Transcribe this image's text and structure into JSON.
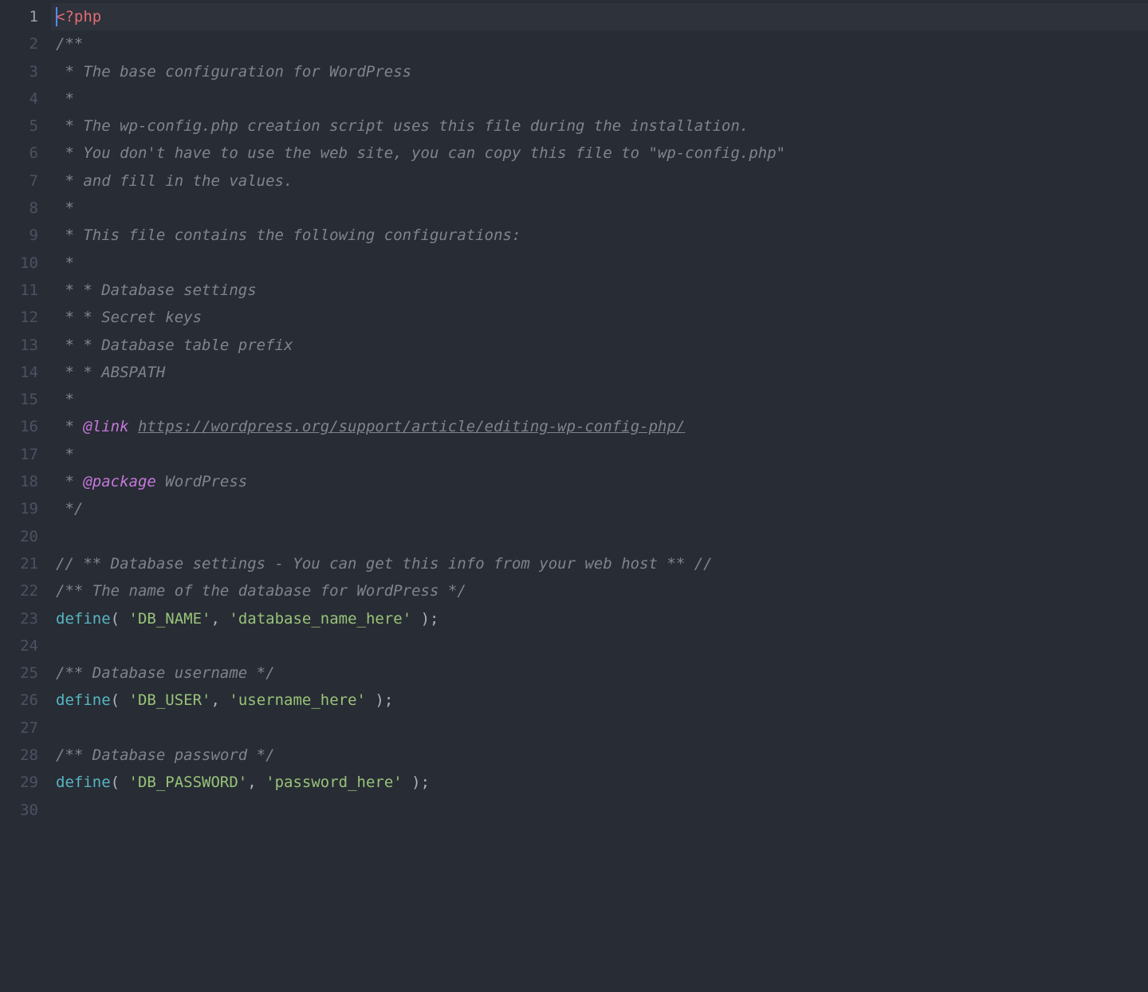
{
  "colors": {
    "background": "#282c34",
    "gutter": "#4b5263",
    "gutter_current": "#9aa1b0",
    "comment": "#7f848e",
    "doctag": "#c678dd",
    "function": "#56b6c2",
    "string": "#98c379",
    "tag": "#e06c75",
    "default": "#abb2bf",
    "cursor": "#528bff"
  },
  "cursor_line": 1,
  "line_count": 30,
  "lines": [
    {
      "n": 1,
      "tokens": [
        {
          "c": "cursor"
        },
        {
          "c": "tag",
          "t": "<?php"
        }
      ]
    },
    {
      "n": 2,
      "tokens": [
        {
          "c": "cmt",
          "t": "/**"
        }
      ]
    },
    {
      "n": 3,
      "tokens": [
        {
          "c": "cmt",
          "t": " * The base configuration for WordPress"
        }
      ]
    },
    {
      "n": 4,
      "tokens": [
        {
          "c": "cmt",
          "t": " *"
        }
      ]
    },
    {
      "n": 5,
      "tokens": [
        {
          "c": "cmt",
          "t": " * The wp-config.php creation script uses this file during the installation."
        }
      ]
    },
    {
      "n": 6,
      "tokens": [
        {
          "c": "cmt",
          "t": " * You don't have to use the web site, you can copy this file to \"wp-config.php\""
        }
      ]
    },
    {
      "n": 7,
      "tokens": [
        {
          "c": "cmt",
          "t": " * and fill in the values."
        }
      ]
    },
    {
      "n": 8,
      "tokens": [
        {
          "c": "cmt",
          "t": " *"
        }
      ]
    },
    {
      "n": 9,
      "tokens": [
        {
          "c": "cmt",
          "t": " * This file contains the following configurations:"
        }
      ]
    },
    {
      "n": 10,
      "tokens": [
        {
          "c": "cmt",
          "t": " *"
        }
      ]
    },
    {
      "n": 11,
      "tokens": [
        {
          "c": "cmt",
          "t": " * * Database settings"
        }
      ]
    },
    {
      "n": 12,
      "tokens": [
        {
          "c": "cmt",
          "t": " * * Secret keys"
        }
      ]
    },
    {
      "n": 13,
      "tokens": [
        {
          "c": "cmt",
          "t": " * * Database table prefix"
        }
      ]
    },
    {
      "n": 14,
      "tokens": [
        {
          "c": "cmt",
          "t": " * * ABSPATH"
        }
      ]
    },
    {
      "n": 15,
      "tokens": [
        {
          "c": "cmt",
          "t": " *"
        }
      ]
    },
    {
      "n": 16,
      "tokens": [
        {
          "c": "cmt",
          "t": " * "
        },
        {
          "c": "doc",
          "t": "@link"
        },
        {
          "c": "cmt",
          "t": " "
        },
        {
          "c": "link",
          "t": "https://wordpress.org/support/article/editing-wp-config-php/"
        }
      ]
    },
    {
      "n": 17,
      "tokens": [
        {
          "c": "cmt",
          "t": " *"
        }
      ]
    },
    {
      "n": 18,
      "tokens": [
        {
          "c": "cmt",
          "t": " * "
        },
        {
          "c": "doc",
          "t": "@package"
        },
        {
          "c": "cmt",
          "t": " WordPress"
        }
      ]
    },
    {
      "n": 19,
      "tokens": [
        {
          "c": "cmt",
          "t": " */"
        }
      ]
    },
    {
      "n": 20,
      "tokens": [
        {
          "c": "pun",
          "t": ""
        }
      ]
    },
    {
      "n": 21,
      "tokens": [
        {
          "c": "cmt",
          "t": "// ** Database settings - You can get this info from your web host ** //"
        }
      ]
    },
    {
      "n": 22,
      "tokens": [
        {
          "c": "cmt",
          "t": "/** The name of the database for WordPress */"
        }
      ]
    },
    {
      "n": 23,
      "tokens": [
        {
          "c": "fn",
          "t": "define"
        },
        {
          "c": "pun",
          "t": "( "
        },
        {
          "c": "str",
          "t": "'DB_NAME'"
        },
        {
          "c": "pun",
          "t": ", "
        },
        {
          "c": "str",
          "t": "'database_name_here'"
        },
        {
          "c": "pun",
          "t": " );"
        }
      ]
    },
    {
      "n": 24,
      "tokens": [
        {
          "c": "pun",
          "t": ""
        }
      ]
    },
    {
      "n": 25,
      "tokens": [
        {
          "c": "cmt",
          "t": "/** Database username */"
        }
      ]
    },
    {
      "n": 26,
      "tokens": [
        {
          "c": "fn",
          "t": "define"
        },
        {
          "c": "pun",
          "t": "( "
        },
        {
          "c": "str",
          "t": "'DB_USER'"
        },
        {
          "c": "pun",
          "t": ", "
        },
        {
          "c": "str",
          "t": "'username_here'"
        },
        {
          "c": "pun",
          "t": " );"
        }
      ]
    },
    {
      "n": 27,
      "tokens": [
        {
          "c": "pun",
          "t": ""
        }
      ]
    },
    {
      "n": 28,
      "tokens": [
        {
          "c": "cmt",
          "t": "/** Database password */"
        }
      ]
    },
    {
      "n": 29,
      "tokens": [
        {
          "c": "fn",
          "t": "define"
        },
        {
          "c": "pun",
          "t": "( "
        },
        {
          "c": "str",
          "t": "'DB_PASSWORD'"
        },
        {
          "c": "pun",
          "t": ", "
        },
        {
          "c": "str",
          "t": "'password_here'"
        },
        {
          "c": "pun",
          "t": " );"
        }
      ]
    },
    {
      "n": 30,
      "tokens": [
        {
          "c": "pun",
          "t": ""
        }
      ]
    }
  ]
}
